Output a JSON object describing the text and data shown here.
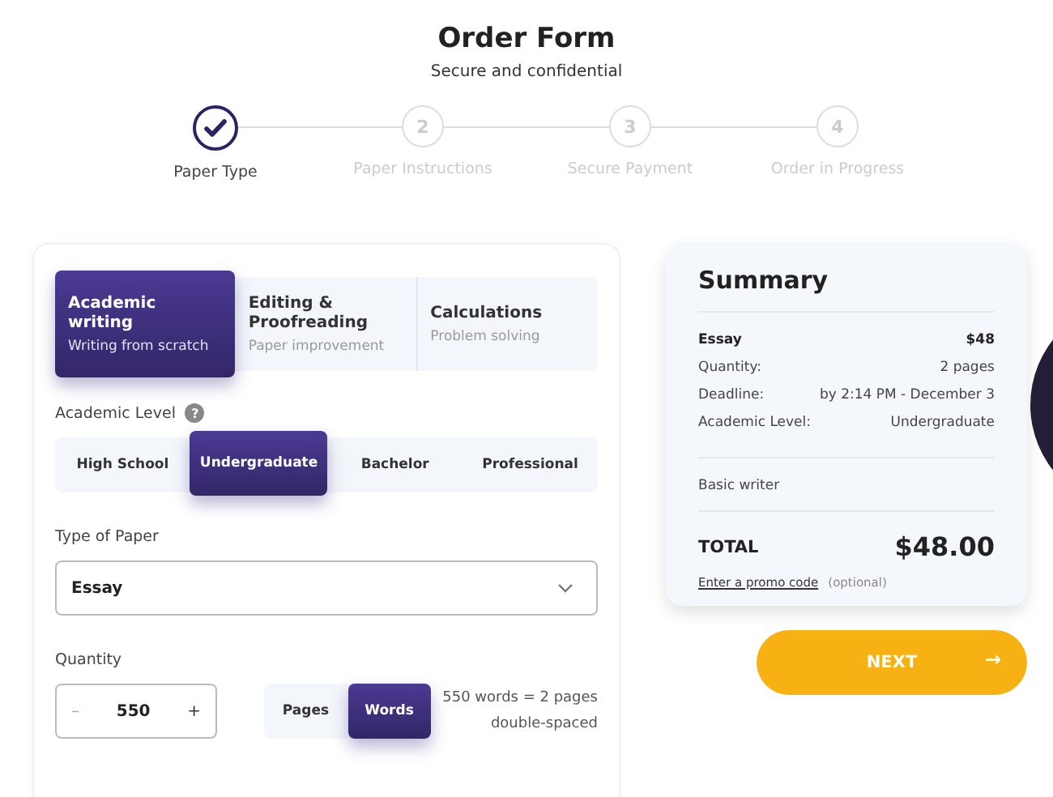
{
  "header": {
    "title": "Order Form",
    "subtitle": "Secure and confidential"
  },
  "steps": [
    {
      "label": "Paper Type",
      "done": true
    },
    {
      "number": "2",
      "label": "Paper Instructions",
      "done": false
    },
    {
      "number": "3",
      "label": "Secure Payment",
      "done": false
    },
    {
      "number": "4",
      "label": "Order in Progress",
      "done": false
    }
  ],
  "service_tabs": [
    {
      "title": "Academic writing",
      "subtitle": "Writing from scratch",
      "selected": true
    },
    {
      "title": "Editing & Proofreading",
      "subtitle": "Paper improvement",
      "selected": false
    },
    {
      "title": "Calculations",
      "subtitle": "Problem solving",
      "selected": false
    }
  ],
  "academic_level": {
    "label": "Academic Level",
    "help": "?",
    "options": [
      {
        "label": "High School",
        "selected": false
      },
      {
        "label": "Undergraduate",
        "selected": true
      },
      {
        "label": "Bachelor",
        "selected": false
      },
      {
        "label": "Professional",
        "selected": false
      }
    ]
  },
  "type_of_paper": {
    "label": "Type of Paper",
    "value": "Essay"
  },
  "quantity": {
    "label": "Quantity",
    "minus": "–",
    "value": "550",
    "plus": "+",
    "units": [
      {
        "label": "Pages",
        "selected": false
      },
      {
        "label": "Words",
        "selected": true
      }
    ],
    "note_line_1": "550 words = 2 pages",
    "note_line_2": "double-spaced"
  },
  "summary": {
    "title": "Summary",
    "rows": [
      {
        "label": "Essay",
        "value": "$48",
        "kind": "heading"
      },
      {
        "label": "Quantity:",
        "value": "2 pages",
        "kind": "detail"
      },
      {
        "label": "Deadline:",
        "value": "by 2:14 PM - December 3",
        "kind": "detail"
      },
      {
        "label": "Academic Level:",
        "value": "Undergraduate",
        "kind": "detail"
      }
    ],
    "writer": "Basic writer",
    "total_label": "TOTAL",
    "total_value": "$48.00",
    "promo_link": "Enter a promo code",
    "promo_note": "(optional)"
  },
  "next_button": {
    "label": "NEXT",
    "arrow": "→"
  }
}
